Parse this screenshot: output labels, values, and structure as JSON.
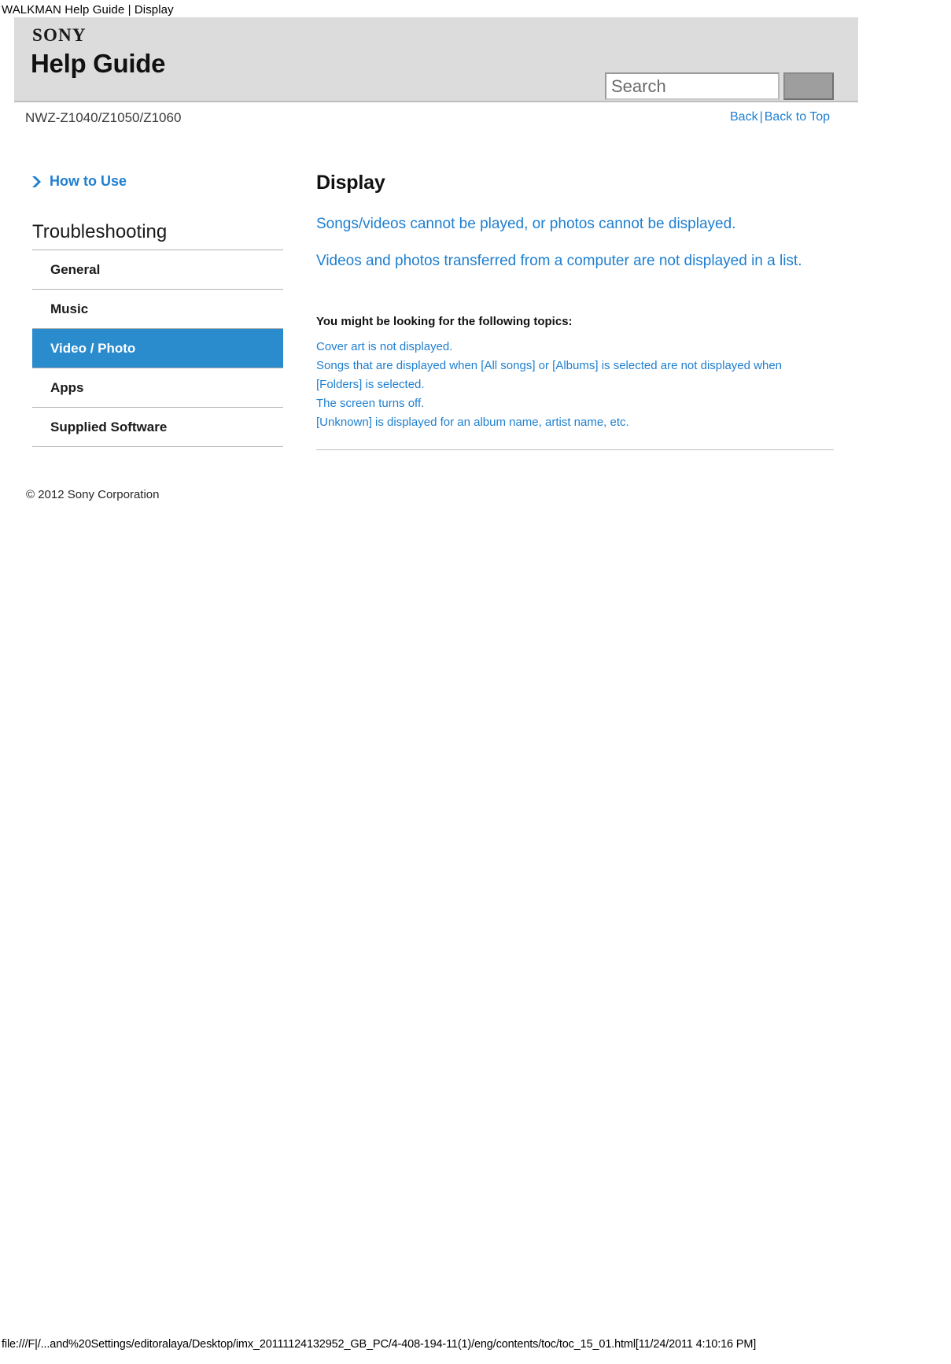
{
  "browser": {
    "print_header": "WALKMAN Help Guide | Display",
    "print_footer": "file:///F|/...and%20Settings/editoralaya/Desktop/imx_20111124132952_GB_PC/4-408-194-11(1)/eng/contents/toc/toc_15_01.html[11/24/2011 4:10:16 PM]"
  },
  "masthead": {
    "brand": "SONY",
    "title": "Help Guide",
    "search": {
      "placeholder": "Search",
      "value": "",
      "button_label": ""
    }
  },
  "subheader": {
    "model": "NWZ-Z1040/Z1050/Z1060",
    "nav": {
      "back": "Back",
      "separator": "|",
      "back_to_top": "Back to Top"
    }
  },
  "sidebar": {
    "how_to_use": "How to Use",
    "section_title": "Troubleshooting",
    "items": [
      {
        "label": "General",
        "active": false
      },
      {
        "label": "Music",
        "active": false
      },
      {
        "label": "Video / Photo",
        "active": true
      },
      {
        "label": "Apps",
        "active": false
      },
      {
        "label": "Supplied Software",
        "active": false
      }
    ],
    "copyright": "© 2012 Sony Corporation"
  },
  "main": {
    "title": "Display",
    "primary_links": [
      "Songs/videos cannot be played, or photos cannot be displayed.",
      "Videos and photos transferred from a computer are not displayed in a list."
    ],
    "topics_heading": "You might be looking for the following topics:",
    "topic_links": [
      "Cover art is not displayed.",
      "Songs that are displayed when [All songs] or [Albums] is selected are not displayed when [Folders] is selected.",
      "The screen turns off.",
      "[Unknown] is displayed for an album name, artist name, etc."
    ]
  },
  "colors": {
    "accent_blue": "#1e7fd0",
    "active_nav": "#2a8bcd",
    "masthead_gray": "#dcdcdc"
  }
}
